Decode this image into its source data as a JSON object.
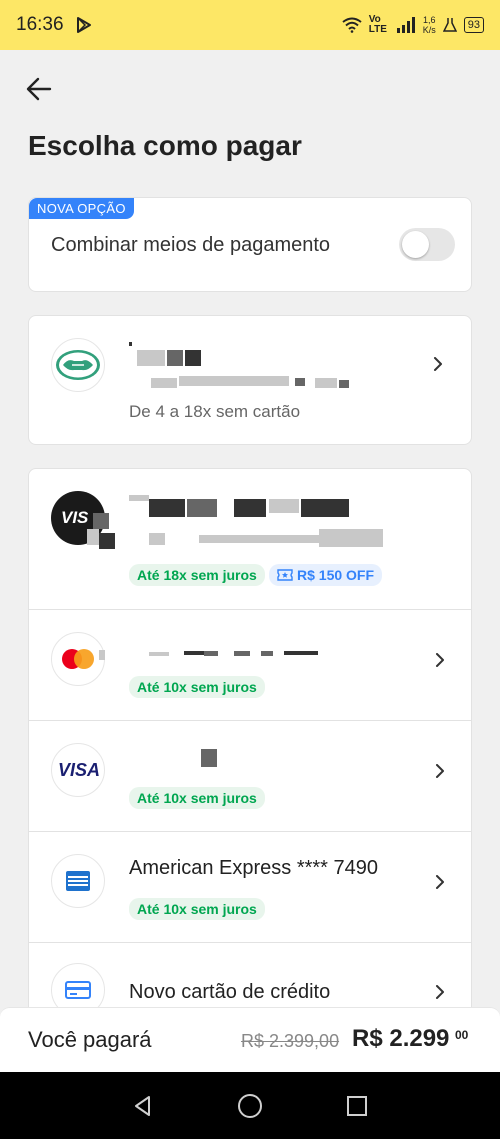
{
  "status_bar": {
    "time": "16:36",
    "network": "Vo LTE",
    "speed_value": "1,6",
    "speed_unit": "K/s",
    "battery": "93"
  },
  "header": {
    "title": "Escolha como pagar"
  },
  "combine": {
    "badge": "NOVA OPÇÃO",
    "label": "Combinar meios de pagamento",
    "enabled": false
  },
  "mercado_pago": {
    "subtitle": "De 4 a 18x sem cartão"
  },
  "cards": [
    {
      "brand": "visa-black",
      "badges": [
        "Até 18x sem juros"
      ],
      "offer": "R$ 150 OFF"
    },
    {
      "brand": "mastercard",
      "badges": [
        "Até 10x sem juros"
      ]
    },
    {
      "brand": "visa",
      "badges": [
        "Até 10x sem juros"
      ]
    },
    {
      "brand": "amex",
      "title": "American Express **** 7490",
      "badges": [
        "Até 10x sem juros"
      ]
    },
    {
      "brand": "new-card",
      "title": "Novo cartão de crédito"
    }
  ],
  "footer": {
    "label": "Você pagará",
    "old_price": "R$ 2.399,00",
    "new_price": "R$ 2.299",
    "new_price_cents": "00"
  },
  "colors": {
    "status_bar": "#fde766",
    "accent_blue": "#3483fa",
    "green": "#00a650"
  }
}
